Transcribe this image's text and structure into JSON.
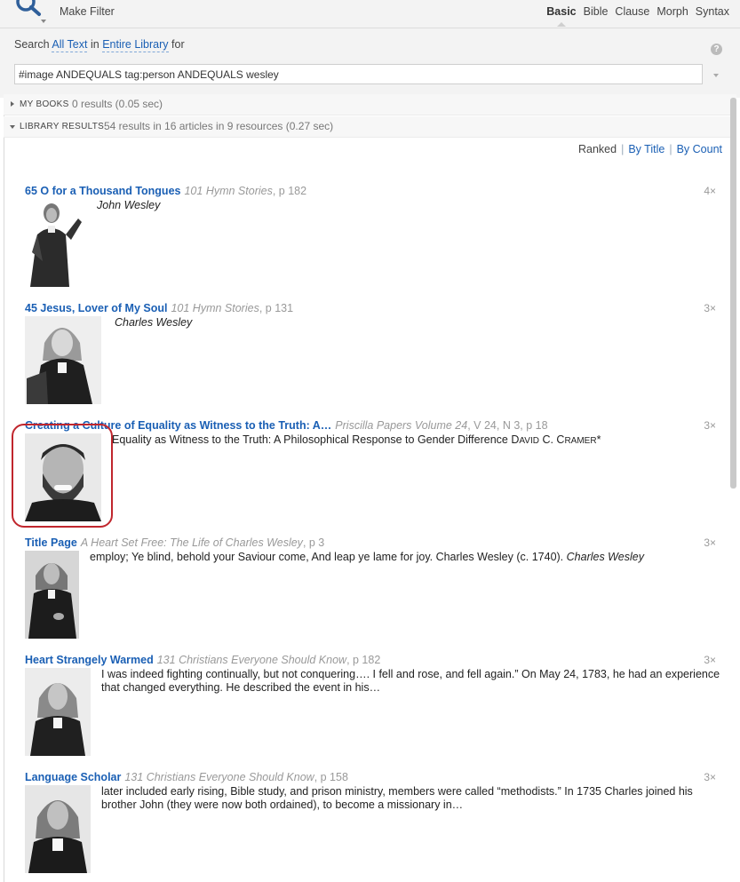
{
  "toolbar": {
    "make_filter": "Make Filter",
    "tabs": [
      "Basic",
      "Bible",
      "Clause",
      "Morph",
      "Syntax"
    ],
    "active_tab": "Basic"
  },
  "search": {
    "prefix": "Search",
    "scope_text": "All Text",
    "in_word": "in",
    "scope_library": "Entire Library",
    "for_word": "for",
    "query": "#image ANDEQUALS tag:person ANDEQUALS wesley",
    "help": "?"
  },
  "sections": {
    "my_books": {
      "title": "MY BOOKS",
      "stats": "0 results (0.05 sec)"
    },
    "library": {
      "title": "LIBRARY RESULTS",
      "stats": "54 results in 16 articles in 9 resources (0.27 sec)"
    }
  },
  "sort": {
    "ranked": "Ranked",
    "by_title": "By Title",
    "by_count": "By Count",
    "separator": "|"
  },
  "results": [
    {
      "title": "65 O for a Thousand Tongues",
      "source": "101 Hymn Stories",
      "page": ", p 182",
      "count": "4×",
      "snippet_italic": "John Wesley",
      "snippet": ""
    },
    {
      "title": "45 Jesus, Lover of My Soul",
      "source": "101 Hymn Stories",
      "page": ", p 131",
      "count": "3×",
      "snippet_italic": "Charles Wesley",
      "snippet": ""
    },
    {
      "title": "Creating a Culture of Equality as Witness to the Truth: A…",
      "source": "Priscilla Papers Volume 24",
      "page": ", V 24, N 3, p 18",
      "count": "3×",
      "snippet_a": "Equality as Witness to the Truth: A Philosophical Response to Gender Difference ",
      "snippet_d": "D",
      "snippet_avid": "AVID",
      "snippet_c": " C. C",
      "snippet_ramer": "RAMER",
      "snippet_star": "*"
    },
    {
      "title": "Title Page",
      "source": "A Heart Set Free: The Life of Charles Wesley",
      "page": ", p 3",
      "count": "3×",
      "snippet": "employ; Ye blind, behold your Saviour come, And leap ye lame for joy. Charles Wesley (c. 1740). ",
      "snippet_italic": "Charles Wesley"
    },
    {
      "title": "Heart Strangely Warmed",
      "source": "131 Christians Everyone Should Know",
      "page": ", p 182",
      "count": "3×",
      "snippet_line1": "I was indeed fighting continually, but not conquering…. I fell and rose, and fell again.” On May 24, 1783, he had an experience",
      "snippet_line2": "that changed everything. He described the event in his…"
    },
    {
      "title": "Language Scholar",
      "source": "131 Christians Everyone Should Know",
      "page": ", p 158",
      "count": "3×",
      "snippet_line1": "later included early rising, Bible study, and prison ministry, members were called “methodists.” In 1735 Charles joined his",
      "snippet_line2": "brother John (they were now both ordained), to become a missionary in…"
    }
  ]
}
